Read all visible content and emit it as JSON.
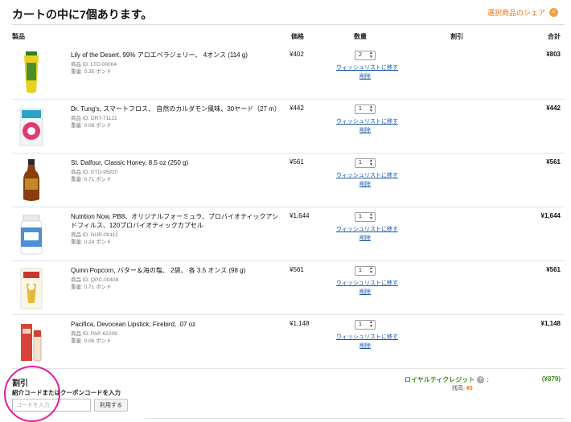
{
  "header": {
    "title": "カートの中に7個あります。",
    "share_label": "選択商品のシェア",
    "share_icon": "share-icon"
  },
  "columns": {
    "product": "製品",
    "price": "価格",
    "quantity": "数量",
    "discount": "割引",
    "total": "合計"
  },
  "actions": {
    "wishlist": "ウィッシュリストに移す",
    "remove": "削除"
  },
  "items": [
    {
      "name": "Lily of the Desert, 99% アロエベラジェリー、 4オンス (114 g)",
      "id": "商品 ID: LTD-00004",
      "weight": "重量: 0.35 ポンド",
      "price": "¥402",
      "qty": "2",
      "total": "¥803"
    },
    {
      "name": "Dr. Tung's, スマートフロス、 自然のカルダモン風味、30ヤード（27 m）",
      "id": "商品 ID: DRT-71121",
      "weight": "重量: 0.08 ポンド",
      "price": "¥442",
      "qty": "1",
      "total": "¥442"
    },
    {
      "name": "St. Dalfour, Classic Honey, 8.5 oz (250 g)",
      "id": "商品 ID: STD-95920",
      "weight": "重量: 0.71 ポンド",
      "price": "¥561",
      "qty": "1",
      "total": "¥561"
    },
    {
      "name": "Nutrition Now, PB8、オリジナルフォーミュラ、プロバイオティックアシドフィルス、120プロバイオティックカプセル",
      "id": "商品 ID: NUR-00112",
      "weight": "重量: 0.24 ポンド",
      "price": "¥1,644",
      "qty": "1",
      "total": "¥1,644"
    },
    {
      "name": "Quinn Popcorn, バター＆海の塩、 2袋、 各 3.5 オンス (98 g)",
      "id": "商品 ID: QPC-00408",
      "weight": "重量: 0.71 ポンド",
      "price": "¥561",
      "qty": "1",
      "total": "¥561"
    },
    {
      "name": "Pacifica, Devocean Lipstick, Firebird, .07 oz",
      "id": "商品 ID: PAP-62209",
      "weight": "重量: 0.06 ポンド",
      "price": "¥1,148",
      "qty": "1",
      "total": "¥1,148"
    }
  ],
  "discount": {
    "title": "割引",
    "subtitle": "紹介コードまたはクーポンコードを入力",
    "placeholder": "コードを入力",
    "apply_label": "利用する"
  },
  "loyalty": {
    "label": "ロイヤルティクレジット",
    "colon": ":",
    "amount": "(¥879)",
    "balance_label": "残高: ",
    "balance_value": "¥0"
  },
  "colors": {
    "accent_orange": "#e8741e",
    "loyalty_green": "#3a8f1f",
    "link_blue": "#1a56a8",
    "highlight_pink": "#e8199a"
  }
}
